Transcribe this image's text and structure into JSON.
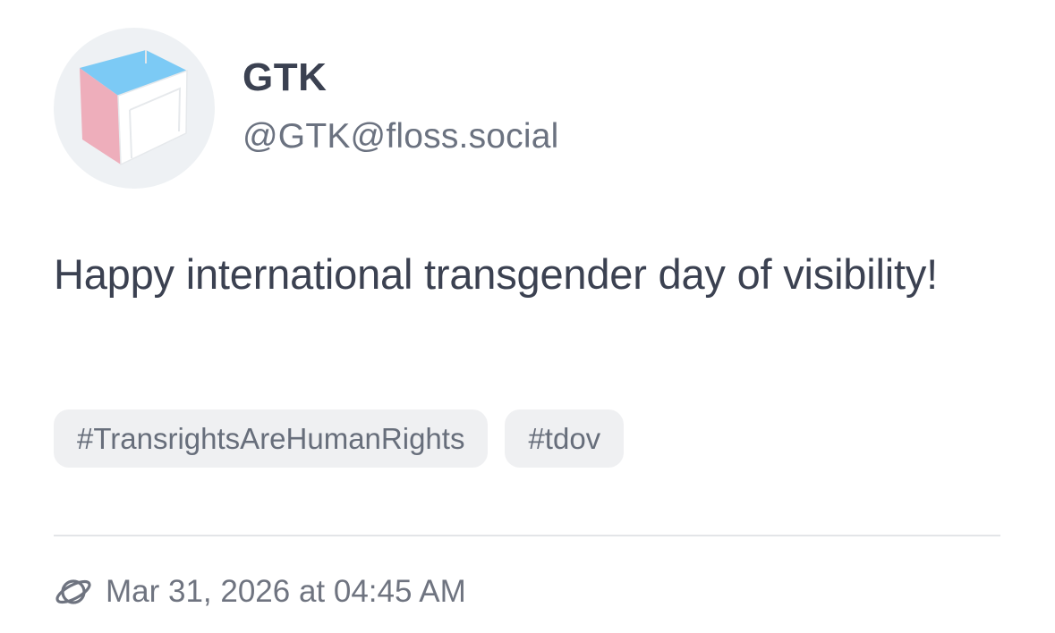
{
  "author": {
    "display_name": "GTK",
    "handle": "@GTK@floss.social",
    "avatar_icon": "gtk-cube-logo"
  },
  "post": {
    "text": "Happy international transgender day of visibility!",
    "hashtags": [
      "#TransrightsAreHumanRights",
      "#tdov"
    ]
  },
  "footer": {
    "visibility_icon": "planet-icon",
    "timestamp": "Mar 31, 2026 at 04:45 AM"
  },
  "colors": {
    "logo_blue": "#7ccaf5",
    "logo_pink": "#eeaebb",
    "text": "#3b4151",
    "muted": "#6b7280",
    "tag_bg": "#eff0f2"
  }
}
